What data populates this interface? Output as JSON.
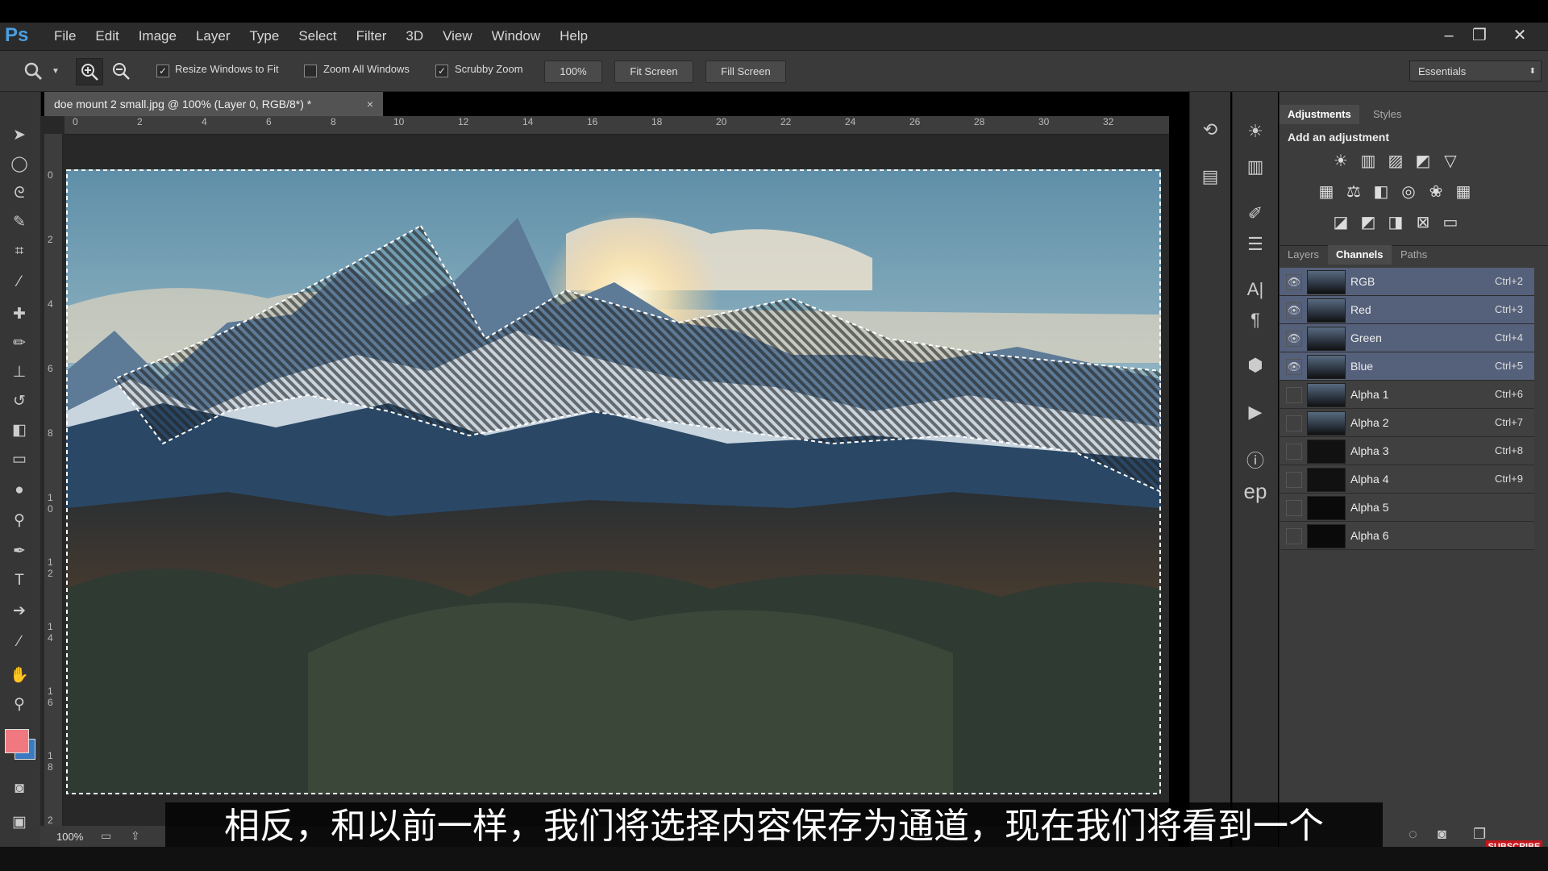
{
  "app": {
    "logo": "Ps"
  },
  "menu": [
    "File",
    "Edit",
    "Image",
    "Layer",
    "Type",
    "Select",
    "Filter",
    "3D",
    "View",
    "Window",
    "Help"
  ],
  "window_controls": {
    "minimize": "–",
    "restore": "❐",
    "close": "✕"
  },
  "options": {
    "resize_windows": "Resize Windows to Fit",
    "zoom_all": "Zoom All Windows",
    "scrubby_zoom": "Scrubby Zoom",
    "zoom_value": "100%",
    "fit_screen": "Fit Screen",
    "fill_screen": "Fill Screen",
    "workspace": "Essentials"
  },
  "document": {
    "tab_title": "doe mount 2 small.jpg @ 100% (Layer 0, RGB/8*) *",
    "close": "×",
    "zoom_status": "100%"
  },
  "ruler": {
    "h": [
      "0",
      "2",
      "4",
      "6",
      "8",
      "10",
      "12",
      "14",
      "16",
      "18",
      "20",
      "22",
      "24",
      "26",
      "28",
      "30",
      "32"
    ],
    "v": [
      "0",
      "2",
      "4",
      "6",
      "8",
      "1 0",
      "1 2",
      "1 4",
      "1 6",
      "1 8",
      "2"
    ]
  },
  "adjustments": {
    "tab_adjustments": "Adjustments",
    "tab_styles": "Styles",
    "heading": "Add an adjustment"
  },
  "panels": {
    "tab_layers": "Layers",
    "tab_channels": "Channels",
    "tab_paths": "Paths"
  },
  "channels": [
    {
      "name": "RGB",
      "shortcut": "Ctrl+2"
    },
    {
      "name": "Red",
      "shortcut": "Ctrl+3"
    },
    {
      "name": "Green",
      "shortcut": "Ctrl+4"
    },
    {
      "name": "Blue",
      "shortcut": "Ctrl+5"
    },
    {
      "name": "Alpha 1",
      "shortcut": "Ctrl+6"
    },
    {
      "name": "Alpha 2",
      "shortcut": "Ctrl+7"
    },
    {
      "name": "Alpha 3",
      "shortcut": "Ctrl+8"
    },
    {
      "name": "Alpha 4",
      "shortcut": "Ctrl+9"
    },
    {
      "name": "Alpha 5",
      "shortcut": ""
    },
    {
      "name": "Alpha 6",
      "shortcut": ""
    }
  ],
  "dock_text": {
    "type_icon": "A|",
    "ep": "ep"
  },
  "subtitle": "相反，和以前一样，我们将选择内容保存为通道，现在我们将看到一个",
  "subscribe": "SUBSCRIBE",
  "colors": {
    "foreground": "#f07880",
    "background": "#3a7ac0",
    "selected_channel": "#55607a"
  }
}
